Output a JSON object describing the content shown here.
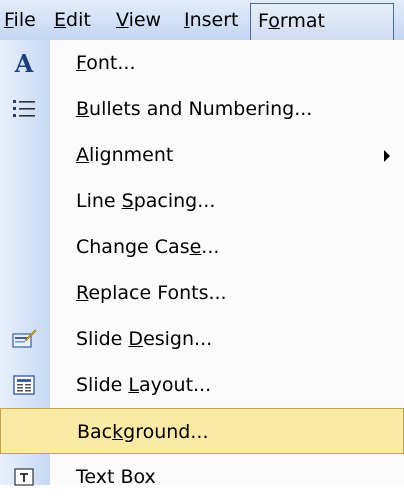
{
  "menubar": {
    "items": [
      {
        "name": "file",
        "pre": "",
        "key": "F",
        "post": "ile"
      },
      {
        "name": "edit",
        "pre": "",
        "key": "E",
        "post": "dit"
      },
      {
        "name": "view",
        "pre": "",
        "key": "V",
        "post": "iew"
      },
      {
        "name": "insert",
        "pre": "",
        "key": "I",
        "post": "nsert"
      },
      {
        "name": "format",
        "pre": "F",
        "key": "o",
        "post": "rmat"
      }
    ]
  },
  "menu": {
    "items": [
      {
        "name": "font",
        "pre": "",
        "key": "F",
        "post": "ont...",
        "icon": "font-icon"
      },
      {
        "name": "bullets-numbering",
        "pre": "",
        "key": "B",
        "post": "ullets and Numbering...",
        "icon": "bullets-icon"
      },
      {
        "name": "alignment",
        "pre": "",
        "key": "A",
        "post": "lignment",
        "submenu": true
      },
      {
        "name": "line-spacing",
        "pre": "Line ",
        "key": "S",
        "post": "pacing..."
      },
      {
        "name": "change-case",
        "pre": "Change Cas",
        "key": "e",
        "post": "..."
      },
      {
        "name": "replace-fonts",
        "pre": "",
        "key": "R",
        "post": "eplace Fonts..."
      },
      {
        "name": "slide-design",
        "pre": "Slide ",
        "key": "D",
        "post": "esign...",
        "icon": "slide-design-icon"
      },
      {
        "name": "slide-layout",
        "pre": "Slide ",
        "key": "L",
        "post": "ayout...",
        "icon": "slide-layout-icon"
      },
      {
        "name": "background",
        "pre": "Bac",
        "key": "k",
        "post": "ground...",
        "highlighted": true
      },
      {
        "name": "text-box",
        "pre": "Text Box",
        "key": "",
        "post": "",
        "icon": "text-box-icon"
      }
    ]
  },
  "colors": {
    "highlight": "#fbe9a6",
    "highlight_border": "#c3a449",
    "gutter": "#c6d8f3"
  }
}
